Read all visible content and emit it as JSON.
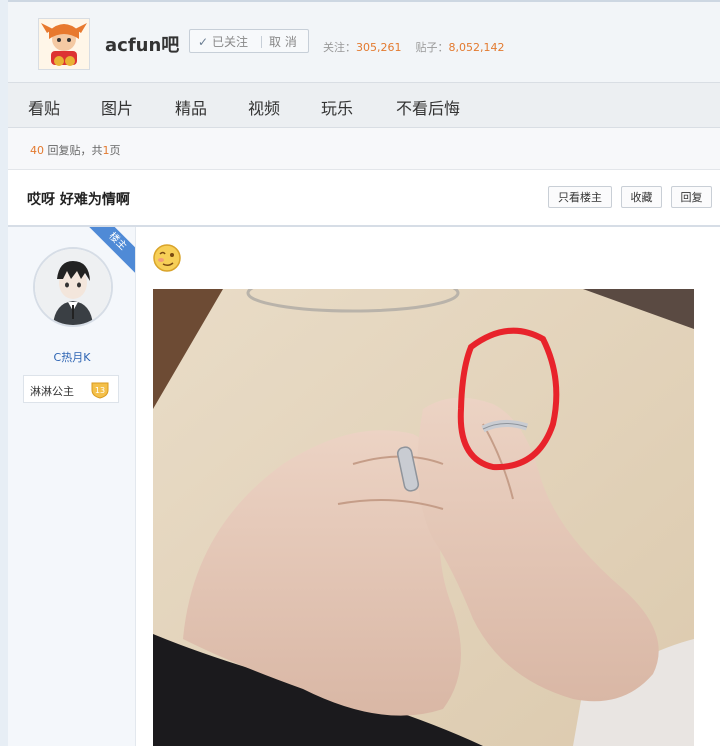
{
  "forum": {
    "name": "acfun吧",
    "follow_check": "✓",
    "followed_label": "已关注",
    "cancel_label": "取 消",
    "followers_label": "关注：",
    "followers_count": "305,261",
    "posts_label": "贴子：",
    "posts_count": "8,052,142"
  },
  "nav": {
    "items": [
      "看贴",
      "图片",
      "精品",
      "视频",
      "玩乐",
      "不看后悔"
    ]
  },
  "reply_bar": {
    "reply_count": "40",
    "reply_label": "回复贴，共",
    "page_count": "1",
    "page_label": "页"
  },
  "thread": {
    "title": "哎呀  好难为情啊",
    "only_op_label": "只看楼主",
    "favorite_label": "收藏",
    "reply_label": "回复"
  },
  "author": {
    "corner_badge": "楼主",
    "name": "C热月K",
    "badge_label": "淋淋公主",
    "level": "13"
  },
  "colors": {
    "accent_orange": "#e37a2f",
    "link_blue": "#2d64b3",
    "corner_blue": "#4f8ad6",
    "annotation_red": "#e8232b"
  }
}
